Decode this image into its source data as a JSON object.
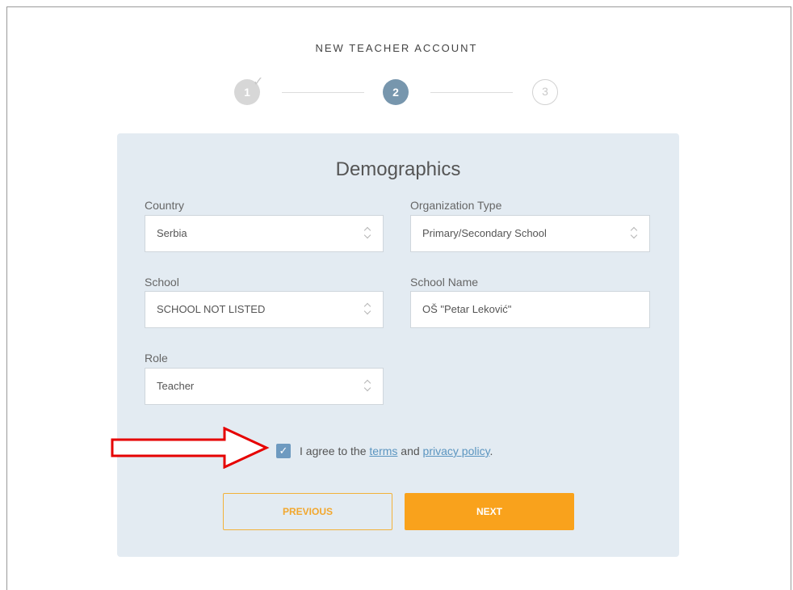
{
  "header": {
    "title": "NEW TEACHER ACCOUNT"
  },
  "stepper": {
    "steps": [
      {
        "label": "1",
        "state": "completed"
      },
      {
        "label": "2",
        "state": "current"
      },
      {
        "label": "3",
        "state": "upcoming"
      }
    ]
  },
  "form": {
    "title": "Demographics",
    "country": {
      "label": "Country",
      "value": "Serbia"
    },
    "organization_type": {
      "label": "Organization Type",
      "value": "Primary/Secondary School"
    },
    "school": {
      "label": "School",
      "value": "SCHOOL NOT LISTED"
    },
    "school_name": {
      "label": "School Name",
      "value": "OŠ \"Petar Leković\""
    },
    "role": {
      "label": "Role",
      "value": "Teacher"
    }
  },
  "agreement": {
    "checked": true,
    "prefix": "I agree to the",
    "terms_link": "terms",
    "and": "and",
    "privacy_link": "privacy policy",
    "suffix": "."
  },
  "buttons": {
    "previous": "PREVIOUS",
    "next": "NEXT"
  },
  "colors": {
    "accent_orange": "#f9a21c",
    "step_active": "#7796ad",
    "panel_bg": "#e3ebf2",
    "annotation_arrow": "#e60000"
  }
}
